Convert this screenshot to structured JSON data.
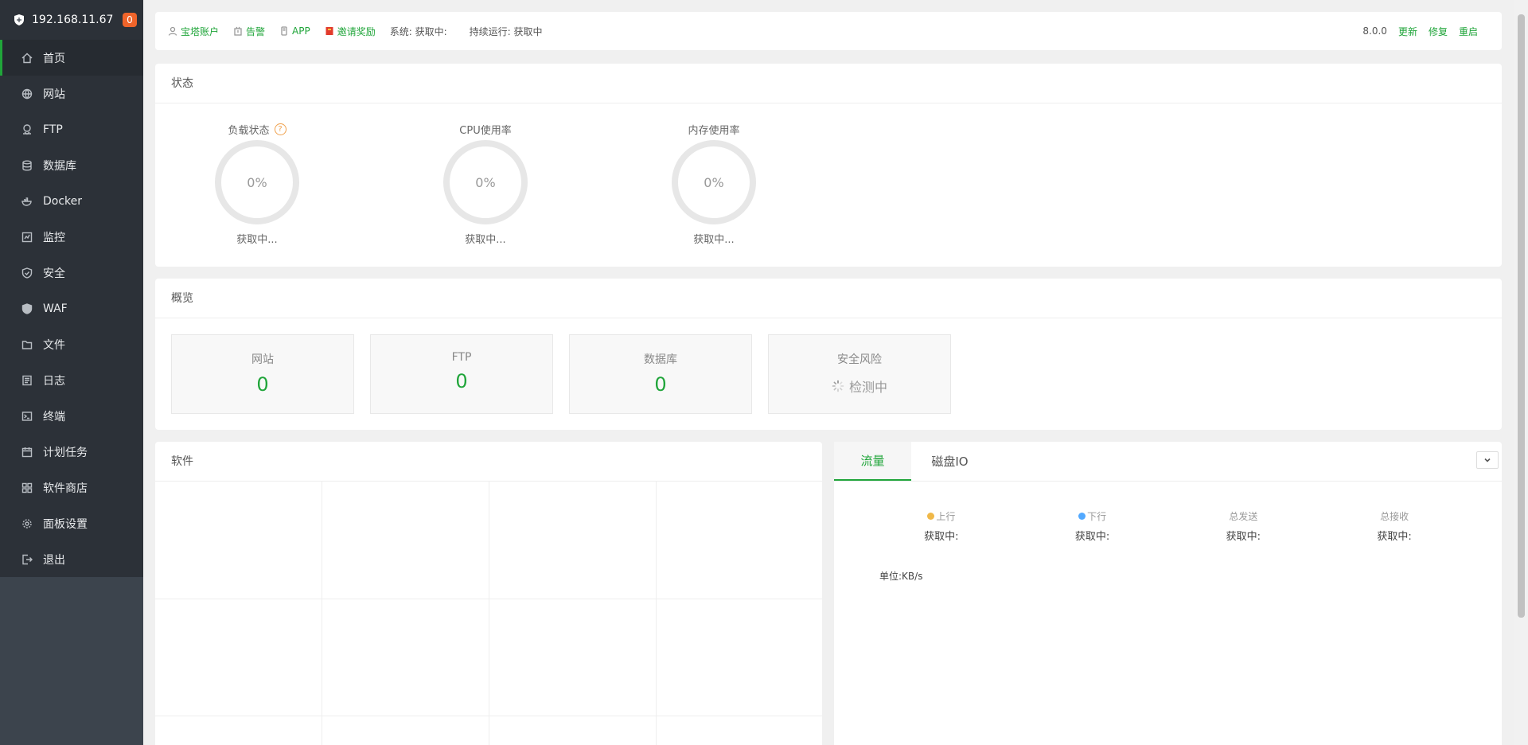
{
  "sidebar": {
    "host": "192.168.11.67",
    "badge": "0",
    "items": [
      {
        "label": "首页",
        "icon": "home-icon"
      },
      {
        "label": "网站",
        "icon": "globe-icon"
      },
      {
        "label": "FTP",
        "icon": "ftp-icon"
      },
      {
        "label": "数据库",
        "icon": "database-icon"
      },
      {
        "label": "Docker",
        "icon": "docker-icon"
      },
      {
        "label": "监控",
        "icon": "monitor-icon"
      },
      {
        "label": "安全",
        "icon": "shield-check-icon"
      },
      {
        "label": "WAF",
        "icon": "waf-shield-icon"
      },
      {
        "label": "文件",
        "icon": "folder-icon"
      },
      {
        "label": "日志",
        "icon": "log-icon"
      },
      {
        "label": "终端",
        "icon": "terminal-icon"
      },
      {
        "label": "计划任务",
        "icon": "calendar-icon"
      },
      {
        "label": "软件商店",
        "icon": "grid-apps-icon"
      },
      {
        "label": "面板设置",
        "icon": "gear-icon"
      },
      {
        "label": "退出",
        "icon": "logout-icon"
      }
    ]
  },
  "topbar": {
    "account": "宝塔账户",
    "alarm": "告警",
    "app": "APP",
    "invite": "邀请奖励",
    "system": "系统:   获取中:",
    "uptime": "持续运行: 获取中",
    "version": "8.0.0",
    "update": "更新",
    "repair": "修复",
    "restart": "重启"
  },
  "status": {
    "title": "状态",
    "gauges": [
      {
        "title": "负载状态",
        "value": "0%",
        "sub": "获取中..."
      },
      {
        "title": "CPU使用率",
        "value": "0%",
        "sub": "获取中..."
      },
      {
        "title": "内存使用率",
        "value": "0%",
        "sub": "获取中..."
      }
    ],
    "help": "?"
  },
  "overview": {
    "title": "概览",
    "cards": [
      {
        "label": "网站",
        "value": "0"
      },
      {
        "label": "FTP",
        "value": "0"
      },
      {
        "label": "数据库",
        "value": "0"
      },
      {
        "label": "安全风险",
        "value": "检测中"
      }
    ]
  },
  "software": {
    "title": "软件"
  },
  "traffic": {
    "tabs": [
      "流量",
      "磁盘IO"
    ],
    "up_color": "#f0b848",
    "down_color": "#52a9ff",
    "stats": [
      {
        "label": "上行",
        "value": "获取中:"
      },
      {
        "label": "下行",
        "value": "获取中:"
      },
      {
        "label": "总发送",
        "value": "获取中:"
      },
      {
        "label": "总接收",
        "value": "获取中:"
      }
    ],
    "unit": "单位:KB/s"
  }
}
